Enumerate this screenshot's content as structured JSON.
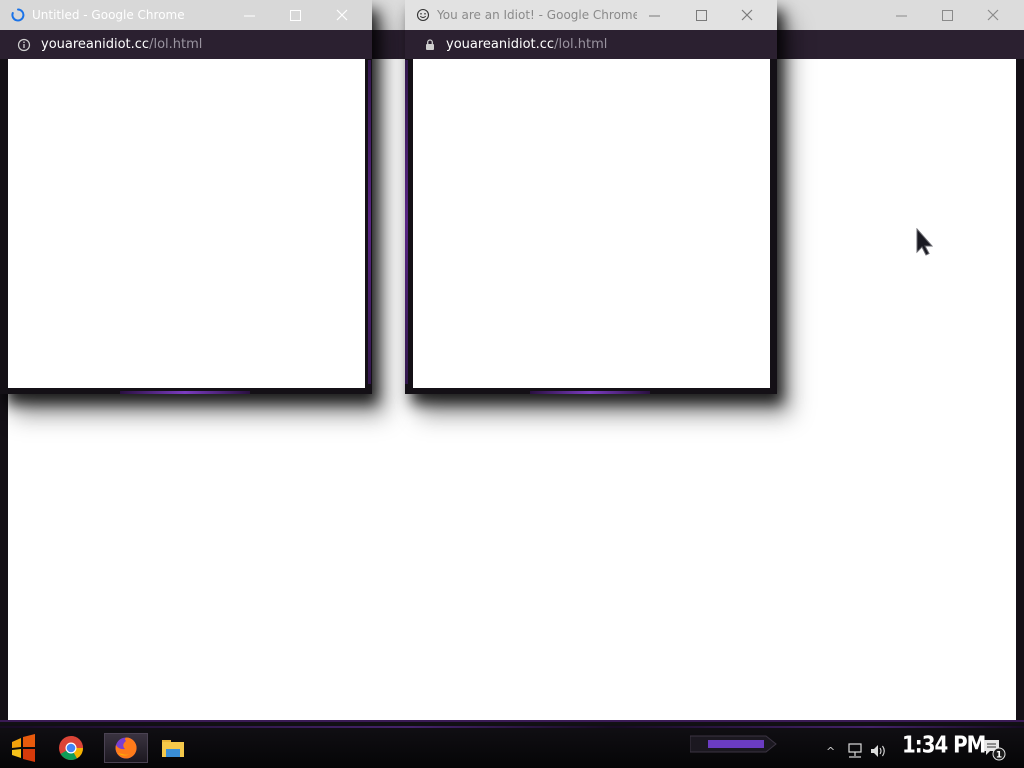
{
  "desktop": {
    "background_color": "#0a0a0c",
    "accent_color": "#6a2aa0"
  },
  "windows": [
    {
      "id": "win1",
      "title": "Untitled - Google Chrome",
      "title_color": "#ffffff",
      "titlebar_color": "#d8d8d8",
      "title_icon": "loading-spinner-icon",
      "url_icon": "info-icon",
      "url_host": "youareanidiot.cc",
      "url_path": "/lol.html"
    },
    {
      "id": "win2",
      "title": "You are an Idiot! - Google Chrome",
      "title_color": "#8a8a8a",
      "titlebar_color": "#e2e2e2",
      "title_icon": "smiley-icon",
      "url_icon": "lock-icon",
      "url_host": "youareanidiot.cc",
      "url_path": "/lol.html"
    },
    {
      "id": "win3",
      "title": "",
      "titlebar_color": "#dcdcdc"
    }
  ],
  "window_controls": {
    "minimize_icon": "minimize-icon",
    "maximize_icon": "maximize-icon",
    "close_icon": "close-icon"
  },
  "taskbar": {
    "items": [
      {
        "name": "start-button",
        "icon": "start-logo-icon"
      },
      {
        "name": "chrome-taskbar-button",
        "icon": "chrome-icon"
      },
      {
        "name": "firefox-taskbar-button",
        "icon": "firefox-icon"
      },
      {
        "name": "file-explorer-taskbar-button",
        "icon": "folder-icon"
      }
    ],
    "tray": {
      "chevron": "^",
      "network_icon": "network-icon",
      "volume_icon": "speaker-icon",
      "notification_icon": "notification-icon",
      "notification_count": "1"
    },
    "clock": "1:34 PM"
  }
}
